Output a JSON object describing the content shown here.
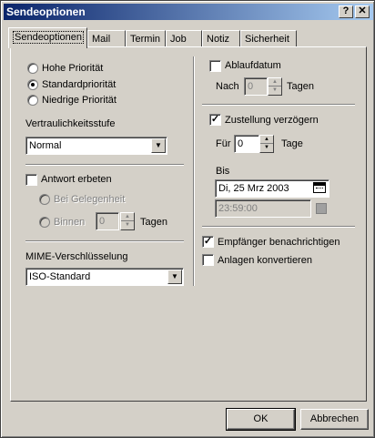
{
  "window": {
    "title": "Sendeoptionen",
    "help_btn": "?",
    "close_btn": "✕"
  },
  "tabs": [
    {
      "label": "Sendeoptionen",
      "active": true
    },
    {
      "label": "Mail"
    },
    {
      "label": "Termin"
    },
    {
      "label": "Job"
    },
    {
      "label": "Notiz"
    },
    {
      "label": "Sicherheit"
    }
  ],
  "priority": {
    "high": "Hohe Priorität",
    "standard": "Standardpriorität",
    "low": "Niedrige Priorität",
    "selected": "standard"
  },
  "confidentiality": {
    "label": "Vertraulichkeitsstufe",
    "value": "Normal"
  },
  "reply": {
    "label": "Antwort erbeten",
    "checked": false,
    "when_convenient": "Bei Gelegenheit",
    "within": "Binnen",
    "days_value": "0",
    "days_label": "Tagen"
  },
  "mime": {
    "label": "MIME-Verschlüsselung",
    "value": "ISO-Standard"
  },
  "expiry": {
    "label": "Ablaufdatum",
    "checked": false,
    "after": "Nach",
    "days_value": "0",
    "days_label": "Tagen"
  },
  "delay": {
    "label": "Zustellung verzögern",
    "checked": true,
    "for": "Für",
    "days_value": "0",
    "days_label": "Tage",
    "until": "Bis",
    "date": "Di, 25 Mrz 2003",
    "time": "23:59:00"
  },
  "notify": {
    "label": "Empfänger benachrichtigen",
    "checked": true
  },
  "convert": {
    "label": "Anlagen konvertieren",
    "checked": false
  },
  "buttons": {
    "ok": "OK",
    "cancel": "Abbrechen"
  },
  "glyphs": {
    "check": "✓",
    "dropdown": "▼",
    "up": "▲",
    "down": "▼"
  }
}
